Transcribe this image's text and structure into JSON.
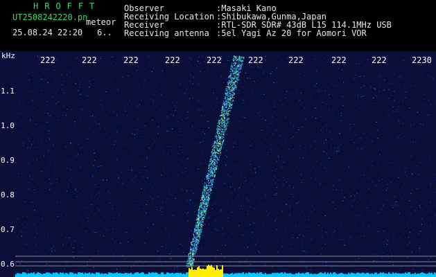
{
  "header": {
    "logo": "HROFFT",
    "filename": "UT2508242220.pn",
    "meteor_label": "meteor",
    "datetime": "25.08.24 22:20",
    "count": "6..",
    "meta": [
      {
        "label": "Observer",
        "value": ":Masaki Kano"
      },
      {
        "label": "Receiving Location",
        "value": ":Shibukawa,Gunma,Japan"
      },
      {
        "label": "Receiver",
        "value": ":RTL-SDR SDR# 43dB L15 114.1MHz USB"
      },
      {
        "label": "Receiving antenna",
        "value": ":5el Yagi Az 20 for Aomori VOR"
      }
    ]
  },
  "spectrogram": {
    "unit_label": "kHz",
    "time_ticks": [
      "222",
      "222",
      "222",
      "222",
      "222",
      "222",
      "222",
      "222",
      "222",
      "2230"
    ],
    "y_ticks": [
      "1.1",
      "1.0",
      "0.9",
      "0.8",
      "0.7",
      "0.6"
    ],
    "colors": {
      "background": "#0a0f3a",
      "axis_text": "#ffffff",
      "noise": "#1a2a8a",
      "trail": "#35e0c8",
      "baseline": "#00c8ff",
      "burst": "#ffee00"
    }
  }
}
